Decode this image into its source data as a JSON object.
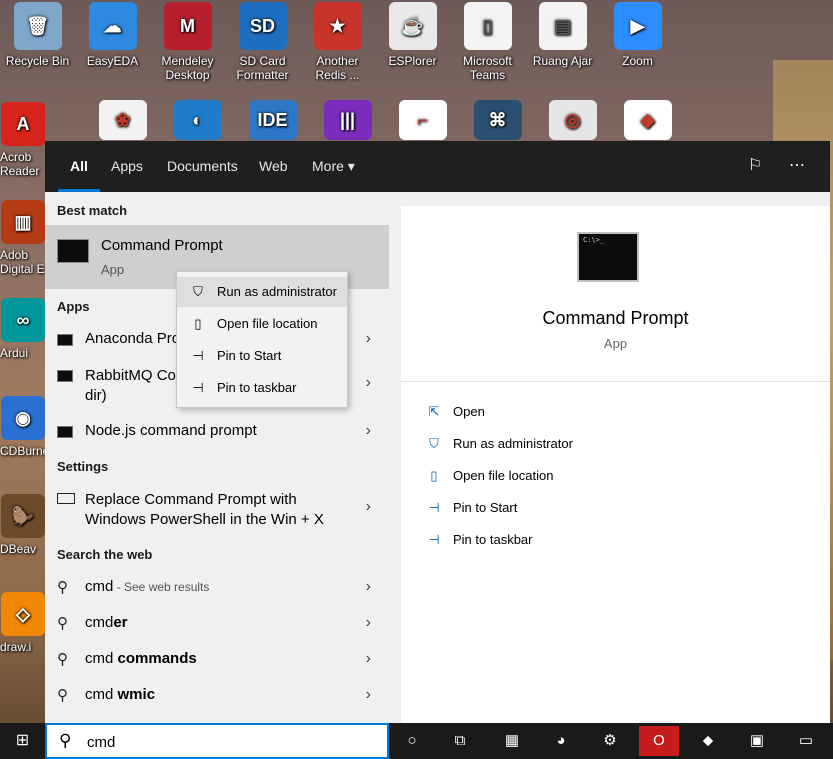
{
  "desktop": {
    "icons": [
      {
        "label": "Recycle Bin",
        "color": "#7fa7c9",
        "glyph": "🗑"
      },
      {
        "label": "EasyEDA",
        "color": "#2f89e0",
        "glyph": "☁"
      },
      {
        "label": "Mendeley Desktop",
        "color": "#b51f2e",
        "glyph": "M"
      },
      {
        "label": "SD Card Formatter",
        "color": "#1f6fc1",
        "glyph": "SD"
      },
      {
        "label": "Another Redis ...",
        "color": "#c8342a",
        "glyph": "★"
      },
      {
        "label": "ESPlorer",
        "color": "#e9e9e9",
        "glyph": "☕"
      },
      {
        "label": "Microsoft Teams",
        "color": "#f3f3f3",
        "glyph": "▯"
      },
      {
        "label": "Ruang Ajar",
        "color": "#f3f3f3",
        "glyph": "▤"
      },
      {
        "label": "Zoom",
        "color": "#2d8cff",
        "glyph": "▶"
      }
    ],
    "left_icons": [
      {
        "label": "Acrob Reader",
        "color": "#d8221c",
        "glyph": "A"
      },
      {
        "label": "Adob Digital E",
        "color": "#b53a16",
        "glyph": "▥"
      },
      {
        "label": "Ardui",
        "color": "#00979c",
        "glyph": "∞"
      },
      {
        "label": "CDBurne",
        "color": "#2a6fd1",
        "glyph": "◉"
      },
      {
        "label": "DBeav",
        "color": "#6b4b2a",
        "glyph": "🦫"
      },
      {
        "label": "draw.i",
        "color": "#f08705",
        "glyph": "◇"
      }
    ],
    "row2_icons": [
      {
        "color": "#f2f2f2",
        "glyph": "❀",
        "name": "flower-app-icon"
      },
      {
        "color": "#1e7cc8",
        "glyph": "◐",
        "name": "edge-icon"
      },
      {
        "color": "#2e77c7",
        "glyph": "IDE",
        "name": "ide-icon"
      },
      {
        "color": "#7a2cbc",
        "glyph": "|||",
        "name": "audio-app-icon"
      },
      {
        "color": "#ffffff",
        "glyph": "⌐",
        "name": "circuit-app-icon"
      },
      {
        "color": "#2b4f6e",
        "glyph": "⌘",
        "name": "network-app-icon"
      },
      {
        "color": "#e6e6e6",
        "glyph": "◎",
        "name": "webcam-app-icon"
      },
      {
        "color": "#ffffff",
        "glyph": "◆",
        "name": "mongodb-icon"
      }
    ]
  },
  "tabs": [
    {
      "label": "All",
      "active": true
    },
    {
      "label": "Apps",
      "active": false
    },
    {
      "label": "Documents",
      "active": false
    },
    {
      "label": "Web",
      "active": false
    },
    {
      "label": "More ▾",
      "active": false
    }
  ],
  "left": {
    "best_match_heading": "Best match",
    "best_match": {
      "title": "Command Prompt",
      "subtitle": "App"
    },
    "apps_heading": "Apps",
    "apps": [
      {
        "label": "Anaconda Pro"
      },
      {
        "label": "RabbitMQ Co\ndir)"
      },
      {
        "label": "Node.js command prompt"
      }
    ],
    "settings_heading": "Settings",
    "settings_item": "Replace Command Prompt with\nWindows PowerShell in the Win + X",
    "web_heading": "Search the web",
    "web": [
      {
        "prefix": "cmd",
        "suffix": " - See web results",
        "suffix_style": "gray"
      },
      {
        "prefix": "cmd",
        "suffix": "er",
        "suffix_style": "bold"
      },
      {
        "prefix": "cmd ",
        "suffix": "commands",
        "suffix_style": "bold"
      },
      {
        "prefix": "cmd ",
        "suffix": "wmic",
        "suffix_style": "bold"
      }
    ]
  },
  "context_menu": {
    "items": [
      {
        "label": "Run as administrator",
        "icon": "shield-icon"
      },
      {
        "label": "Open file location",
        "icon": "file-location-icon"
      },
      {
        "label": "Pin to Start",
        "icon": "pin-icon"
      },
      {
        "label": "Pin to taskbar",
        "icon": "pin-icon"
      }
    ]
  },
  "detail": {
    "title": "Command Prompt",
    "subtitle": "App",
    "actions": [
      {
        "label": "Open",
        "icon": "open-icon"
      },
      {
        "label": "Run as administrator",
        "icon": "shield-icon"
      },
      {
        "label": "Open file location",
        "icon": "file-location-icon"
      },
      {
        "label": "Pin to Start",
        "icon": "pin-icon"
      },
      {
        "label": "Pin to taskbar",
        "icon": "pin-icon"
      }
    ]
  },
  "taskbar": {
    "search_value": "cmd",
    "apps": [
      {
        "name": "cortana-icon",
        "glyph": "○",
        "bg": "#1a1a1a"
      },
      {
        "name": "task-view-icon",
        "glyph": "⧉",
        "bg": "#1a1a1a"
      },
      {
        "name": "app-green-icon",
        "glyph": "▦",
        "bg": "#1a1a1a"
      },
      {
        "name": "app-blue-circle-icon",
        "glyph": "◕",
        "bg": "#1a1a1a"
      },
      {
        "name": "network-user-icon",
        "glyph": "⚙",
        "bg": "#1a1a1a"
      },
      {
        "name": "opera-icon",
        "glyph": "O",
        "bg": "#c51d1d"
      },
      {
        "name": "dice-app-icon",
        "glyph": "⬥",
        "bg": "#1a1a1a"
      },
      {
        "name": "id-card-app-icon",
        "glyph": "▣",
        "bg": "#1a1a1a"
      },
      {
        "name": "file-explorer-icon",
        "glyph": "▭",
        "bg": "#1a1a1a"
      }
    ]
  }
}
